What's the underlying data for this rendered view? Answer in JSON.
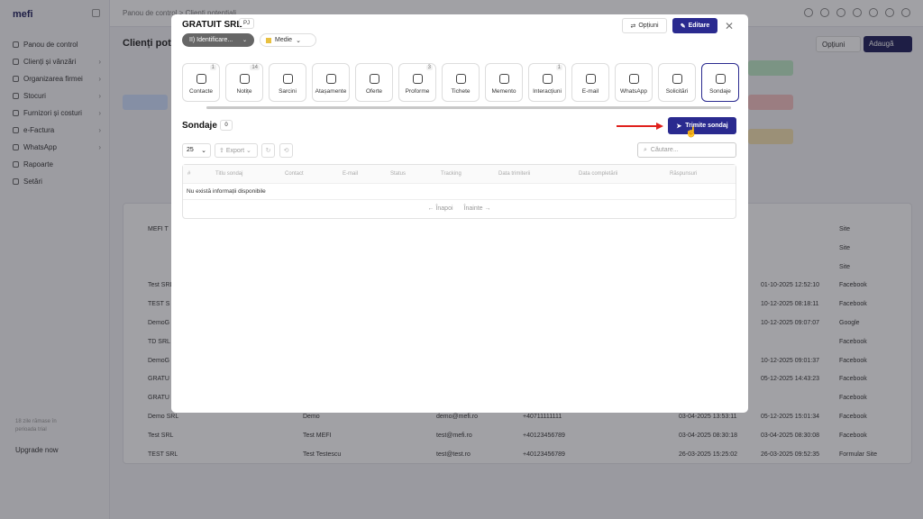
{
  "background": {
    "logo": "mefi",
    "breadcrumb": "Panou de control  >  Clienți potențiali",
    "page_title": "Clienți pote",
    "options_label": "Opțiuni",
    "add_label": "Adaugă",
    "nav": [
      "Panou de control",
      "Clienți și vânzări",
      "Organizarea firmei",
      "Stocuri",
      "Furnizori și costuri",
      "e-Factura",
      "WhatsApp",
      "Rapoarte",
      "Setări"
    ],
    "sidebar_footer": "18 zile rămase în\nperioada trial",
    "upgrade": "Upgrade now",
    "rows": [
      {
        "company": "MEFI T",
        "source": "Site"
      },
      {
        "company": "",
        "source": "Site"
      },
      {
        "company": "",
        "source": "Site"
      },
      {
        "company": "Test SRL",
        "date": "01-10-2025 12:52:10",
        "source": "Facebook"
      },
      {
        "company": "TEST S",
        "date": "10-12-2025 08:18:11",
        "source": "Facebook"
      },
      {
        "company": "DemoG",
        "date": "10-12-2025 09:07:07",
        "source": "Google"
      },
      {
        "company": "TD SRL",
        "date": "",
        "source": "Facebook"
      },
      {
        "company": "DemoG",
        "date": "10-12-2025 09:01:37",
        "source": "Facebook"
      },
      {
        "company": "GRATU",
        "date": "05-12-2025 14:43:23",
        "source": "Facebook"
      },
      {
        "company": "GRATU",
        "date": "",
        "source": "Facebook"
      },
      {
        "company": "Demo SRL",
        "contact": "Demo",
        "email": "demo@mefi.ro",
        "phone": "+40711111111",
        "date1": "03-04-2025 13:53:11",
        "date": "05-12-2025 15:01:34",
        "source": "Facebook"
      },
      {
        "company": "Test SRL",
        "contact": "Test MEFI",
        "email": "test@mefi.ro",
        "phone": "+40123456789",
        "date1": "03-04-2025 08:30:18",
        "date": "03-04-2025 08:30:08",
        "source": "Facebook"
      },
      {
        "company": "TEST SRL",
        "contact": "Test Testescu",
        "email": "test@test.ro",
        "phone": "+40123456789",
        "date1": "26-03-2025 15:25:02",
        "date": "26-03-2025 09:52:35",
        "source": "Formular Site"
      }
    ]
  },
  "modal": {
    "title": "GRATUIT SRL",
    "type_badge": "PJ",
    "stage": "II) Identificare...",
    "priority": "Medie",
    "options_label": "Opțiuni",
    "edit_label": "Editare",
    "tabs": [
      {
        "label": "Contacte",
        "badge": "1"
      },
      {
        "label": "Notițe",
        "badge": "14"
      },
      {
        "label": "Sarcini",
        "badge": ""
      },
      {
        "label": "Atașamente",
        "badge": ""
      },
      {
        "label": "Oferte",
        "badge": ""
      },
      {
        "label": "Proforme",
        "badge": "3"
      },
      {
        "label": "Tichete",
        "badge": ""
      },
      {
        "label": "Memento",
        "badge": ""
      },
      {
        "label": "Interacțiuni",
        "badge": "1"
      },
      {
        "label": "E-mail",
        "badge": ""
      },
      {
        "label": "WhatsApp",
        "badge": ""
      },
      {
        "label": "Solicitări",
        "badge": ""
      },
      {
        "label": "Sondaje",
        "badge": ""
      }
    ],
    "active_tab": "Sondaje",
    "section_title": "Sondaje",
    "section_count": "0",
    "send_label": "Trimite sondaj",
    "per_page": "25",
    "export_label": "Export",
    "search_placeholder": "Căutare...",
    "columns": [
      "#",
      "Titlu sondaj",
      "Contact",
      "E-mail",
      "Status",
      "Tracking",
      "Data trimiterii",
      "Data completării",
      "Răspunsuri"
    ],
    "empty_text": "Nu există informații disponibile",
    "prev_label": "← Înapoi",
    "next_label": "Înainte →"
  },
  "colors": {
    "accent": "#2a2a8f",
    "arrow": "#e0201c",
    "overlay": "rgba(30,30,40,0.42)"
  }
}
